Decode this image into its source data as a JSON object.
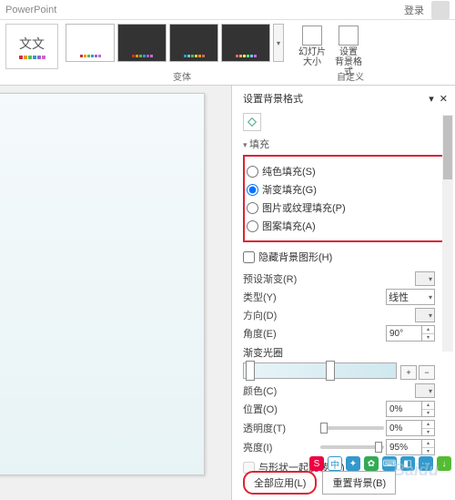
{
  "app": {
    "name": "PowerPoint",
    "login": "登录"
  },
  "ribbon": {
    "theme_text": "文文",
    "variants_label": "变体",
    "custom_label": "自定义",
    "slidesize": "幻灯片\n大小",
    "formatbg": "设置\n背景格式"
  },
  "panel": {
    "title": "设置背景格式",
    "pin": "▾",
    "close": "✕",
    "fill_section": "填充",
    "radios": {
      "solid": "纯色填充(S)",
      "gradient": "渐变填充(G)",
      "picture": "图片或纹理填充(P)",
      "pattern": "图案填充(A)"
    },
    "hide_bg": "隐藏背景图形(H)",
    "preset": "预设渐变(R)",
    "type": "类型(Y)",
    "type_val": "线性",
    "direction": "方向(D)",
    "angle": "角度(E)",
    "angle_val": "90°",
    "stops": "渐变光圈",
    "color": "颜色(C)",
    "position": "位置(O)",
    "position_val": "0%",
    "transparency": "透明度(T)",
    "transparency_val": "0%",
    "brightness": "亮度(I)",
    "brightness_val": "95%",
    "rotate": "与形状一起旋转(W)",
    "apply_all": "全部应用(L)",
    "reset": "重置背景(B)"
  },
  "float": {
    "ime": "中"
  }
}
